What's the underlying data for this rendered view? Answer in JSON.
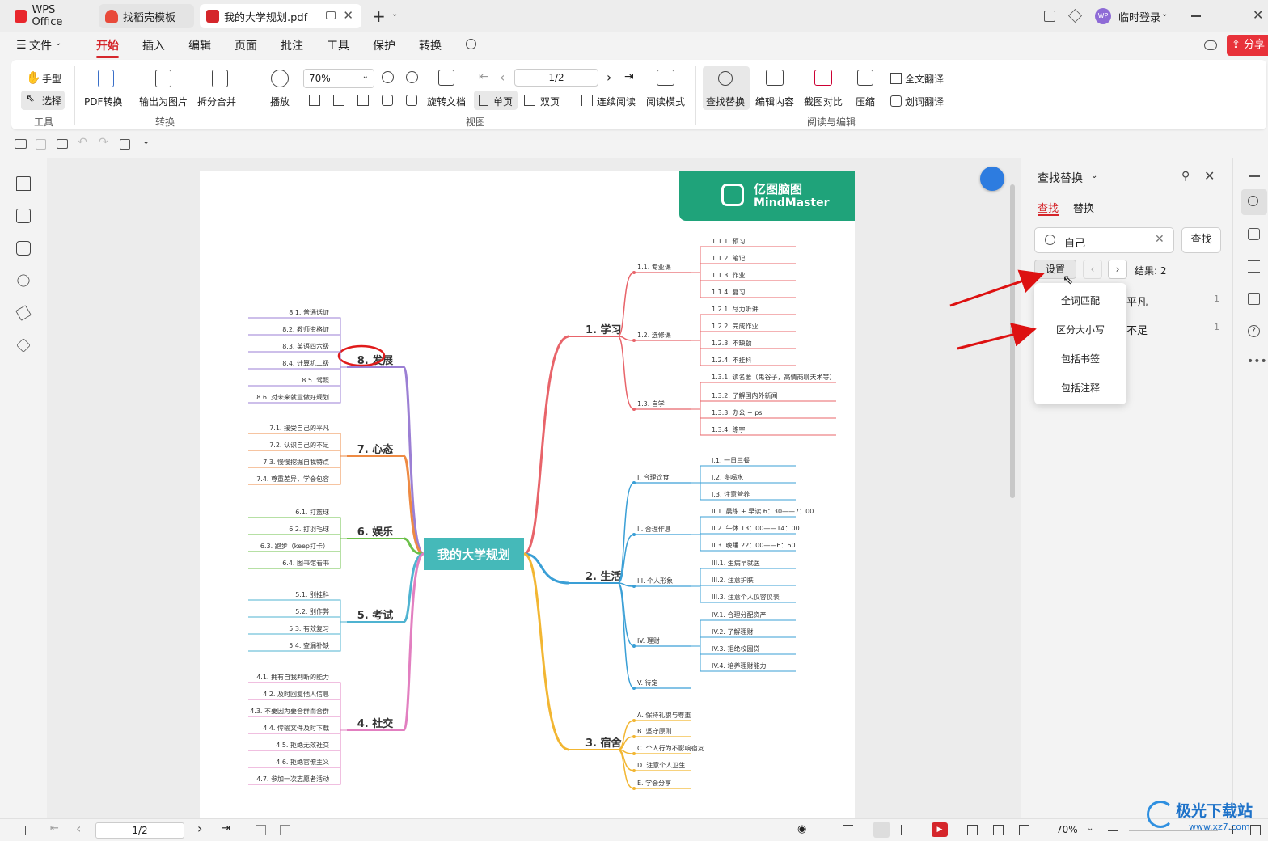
{
  "tabs": [
    {
      "label": "WPS Office"
    },
    {
      "label": "找稻壳模板"
    },
    {
      "label": "我的大学规划.pdf"
    }
  ],
  "window": {
    "login": "临时登录",
    "avatar": "WP"
  },
  "menu": {
    "file": "文件",
    "items": [
      "开始",
      "插入",
      "编辑",
      "页面",
      "批注",
      "工具",
      "保护",
      "转换"
    ],
    "share": "分享"
  },
  "ribbon": {
    "hand": "手型",
    "select": "选择",
    "tools_group": "工具",
    "pdf_convert": "PDF转换",
    "export_image": "输出为图片",
    "split_merge": "拆分合并",
    "convert_group": "转换",
    "play": "播放",
    "zoom": "70%",
    "page_input": "1/2",
    "rotate": "旋转文档",
    "single": "单页",
    "double": "双页",
    "continuous": "连续阅读",
    "read_mode": "阅读模式",
    "view_group": "视图",
    "find_replace": "查找替换",
    "edit_content": "编辑内容",
    "screenshot_compare": "截图对比",
    "compress": "压缩",
    "full_translate": "全文翻译",
    "word_translate": "划词翻译",
    "read_edit_group": "阅读与编辑"
  },
  "panel": {
    "title": "查找替换",
    "tab_find": "查找",
    "tab_replace": "替换",
    "search_value": "自己",
    "find_button": "查找",
    "settings_button": "设置",
    "result_label": "结果: 2",
    "results": [
      {
        "text": "平凡",
        "count": "1"
      },
      {
        "text": "不足",
        "count": "1"
      }
    ],
    "dropdown": [
      "全词匹配",
      "区分大小写",
      "包括书签",
      "包括注释"
    ]
  },
  "status": {
    "page": "1/2",
    "zoom": "70%"
  },
  "watermark": {
    "brand": "亿图脑图",
    "sub": "MindMaster",
    "site": "极光下载站",
    "url": "www.xz7.com"
  },
  "mindmap": {
    "center": "我的大学规划",
    "right": [
      {
        "label": "1. 学习",
        "color": "#e8646a",
        "children": [
          {
            "label": "1.1. 专业课",
            "leaves": [
              "1.1.1. 预习",
              "1.1.2. 笔记",
              "1.1.3. 作业",
              "1.1.4. 复习"
            ]
          },
          {
            "label": "1.2. 选修课",
            "leaves": [
              "1.2.1. 尽力听讲",
              "1.2.2. 完成作业",
              "1.2.3. 不缺勤",
              "1.2.4. 不挂科"
            ]
          },
          {
            "label": "1.3. 自学",
            "leaves": [
              "1.3.1. 读名著（鬼谷子，高情商聊天术等）",
              "1.3.2. 了解国内外新闻",
              "1.3.3. 办公 + ps",
              "1.3.4. 练字"
            ]
          }
        ]
      },
      {
        "label": "2. 生活",
        "color": "#3a9fd6",
        "children": [
          {
            "label": "I. 合理饮食",
            "leaves": [
              "I.1. 一日三餐",
              "I.2. 多喝水",
              "I.3. 注意营养"
            ]
          },
          {
            "label": "II. 合理作息",
            "leaves": [
              "II.1. 晨练 + 早读 6：30——7：00",
              "II.2. 午休 13：00——14：00",
              "II.3. 晚睡 22：00——6：60"
            ]
          },
          {
            "label": "III. 个人形象",
            "leaves": [
              "III.1. 生病早就医",
              "III.2. 注意护肤",
              "III.3. 注意个人仪容仪表"
            ]
          },
          {
            "label": "IV. 理财",
            "leaves": [
              "IV.1. 合理分配资产",
              "IV.2. 了解理财",
              "IV.3. 拒绝校园贷",
              "IV.4. 培养理财能力"
            ]
          },
          {
            "label": "V. 待定",
            "leaves": []
          }
        ]
      },
      {
        "label": "3. 宿舍",
        "color": "#f2b632",
        "children": [
          {
            "label": "A. 保持礼貌与尊重",
            "leaves": []
          },
          {
            "label": "B. 坚守原则",
            "leaves": []
          },
          {
            "label": "C. 个人行为不影响宿友",
            "leaves": []
          },
          {
            "label": "D. 注意个人卫生",
            "leaves": []
          },
          {
            "label": "E. 学会分享",
            "leaves": []
          }
        ]
      }
    ],
    "left": [
      {
        "label": "8. 发展",
        "color": "#9b7fd4",
        "leaves": [
          "8.1. 普通话证",
          "8.2. 教师资格证",
          "8.3. 英语四六级",
          "8.4. 计算机二级",
          "8.5. 驾照",
          "8.6. 对未来就业做好规划"
        ]
      },
      {
        "label": "7. 心态",
        "color": "#ee8a43",
        "leaves": [
          "7.1. 接受自己的平凡",
          "7.2. 认识自己的不足",
          "7.3. 慢慢挖掘自我特点",
          "7.4. 尊重差异，学会包容"
        ]
      },
      {
        "label": "6. 娱乐",
        "color": "#6cc04a",
        "leaves": [
          "6.1. 打篮球",
          "6.2. 打羽毛球",
          "6.3. 跑步（keep打卡）",
          "6.4. 图书馆看书"
        ]
      },
      {
        "label": "5. 考试",
        "color": "#4fb3d1",
        "leaves": [
          "5.1. 别挂科",
          "5.2. 别作弊",
          "5.3. 有效复习",
          "5.4. 查漏补缺"
        ]
      },
      {
        "label": "4. 社交",
        "color": "#e27fc0",
        "leaves": [
          "4.1. 拥有自我判断的能力",
          "4.2. 及时回复他人信息",
          "4.3. 不要因为要合群而合群",
          "4.4. 传输文件及时下载",
          "4.5. 拒绝无效社交",
          "4.6. 拒绝官僚主义",
          "4.7. 参加一次志愿者活动"
        ]
      }
    ]
  }
}
